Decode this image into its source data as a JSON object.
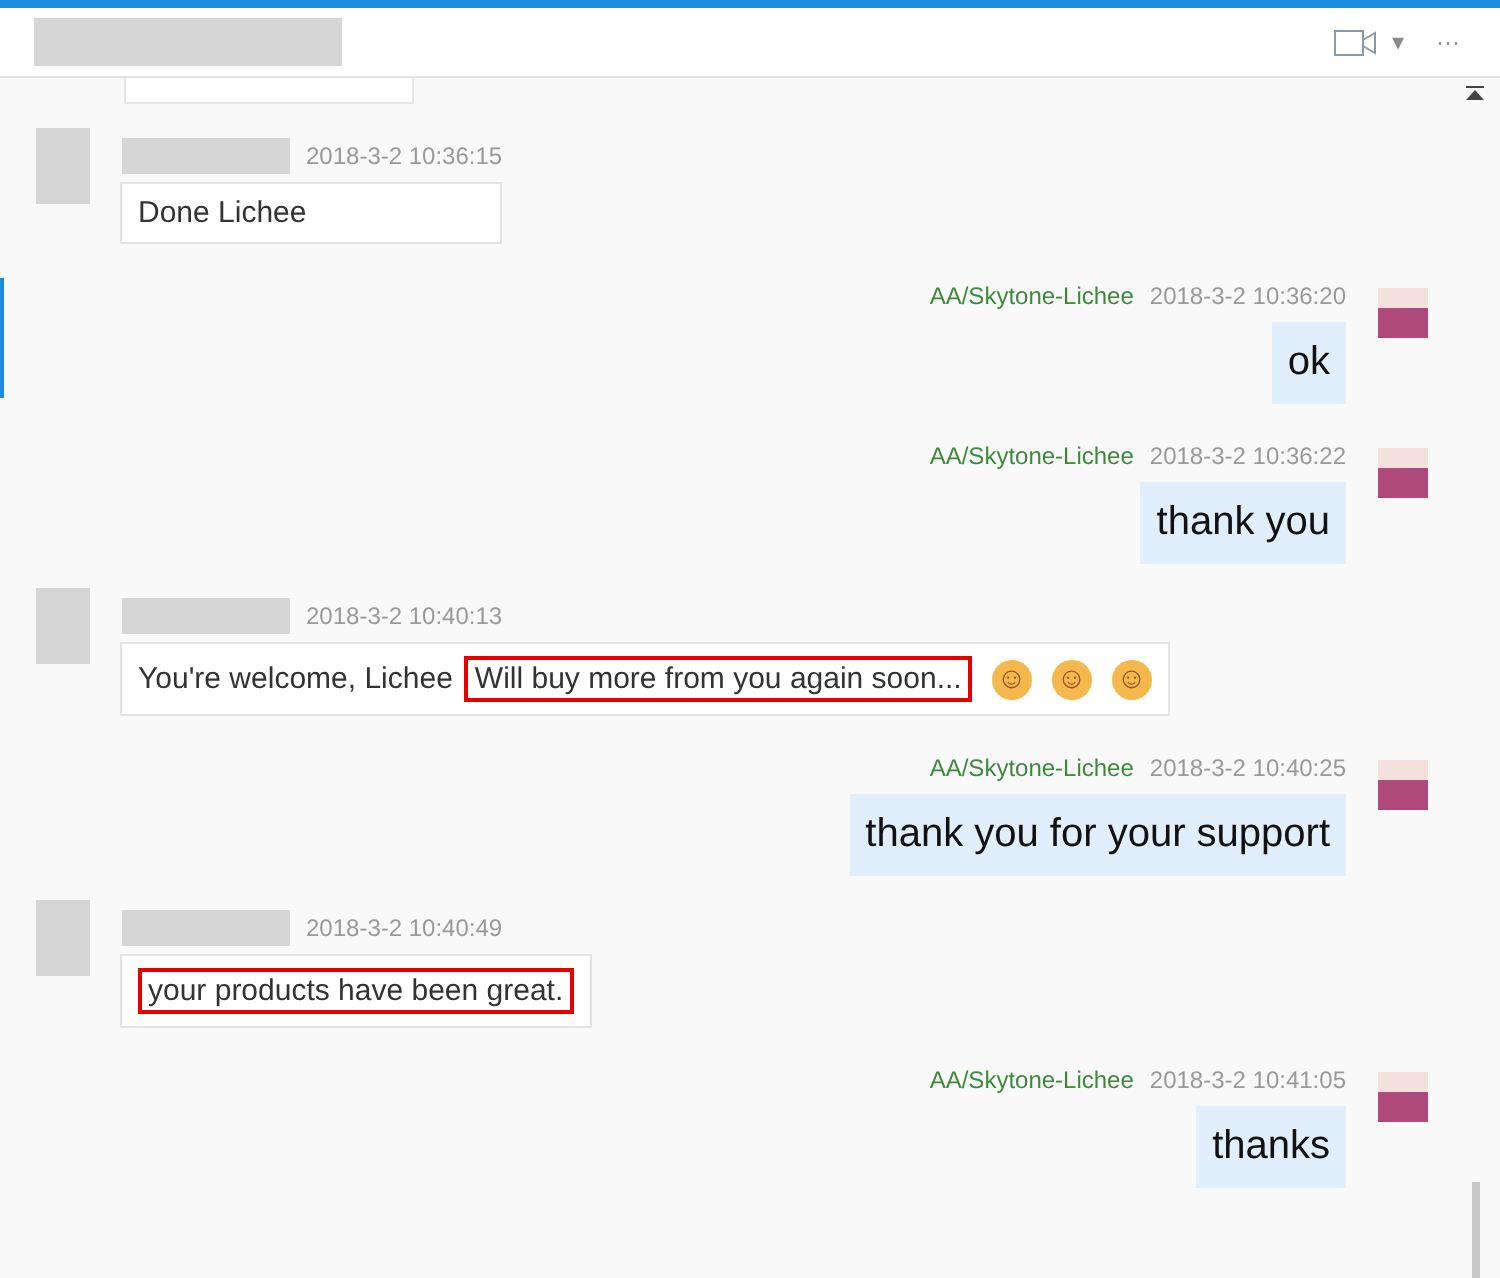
{
  "header": {
    "actions": [
      "▾",
      "···"
    ]
  },
  "messages": [
    {
      "kind": "incoming",
      "time": "2018-3-2 10:36:15",
      "parts": [
        {
          "text": "Done Lichee",
          "highlighted": false
        }
      ]
    },
    {
      "kind": "outgoing",
      "sender": "AA/Skytone-Lichee",
      "time": "2018-3-2 10:36:20",
      "parts": [
        {
          "text": "ok",
          "highlighted": false
        }
      ]
    },
    {
      "kind": "outgoing",
      "sender": "AA/Skytone-Lichee",
      "time": "2018-3-2 10:36:22",
      "parts": [
        {
          "text": "thank you",
          "highlighted": false
        }
      ]
    },
    {
      "kind": "incoming",
      "time": "2018-3-2 10:40:13",
      "parts": [
        {
          "text": "You're welcome, Lichee",
          "highlighted": false
        },
        {
          "text": "Will buy more from you again soon...",
          "highlighted": true
        }
      ],
      "emojis": [
        "☺",
        "☺",
        "☺"
      ]
    },
    {
      "kind": "outgoing",
      "sender": "AA/Skytone-Lichee",
      "time": "2018-3-2 10:40:25",
      "parts": [
        {
          "text": "thank you for your support",
          "highlighted": false
        }
      ]
    },
    {
      "kind": "incoming",
      "time": "2018-3-2 10:40:49",
      "parts": [
        {
          "text": "your products have been great.",
          "highlighted": true
        }
      ]
    },
    {
      "kind": "outgoing",
      "sender": "AA/Skytone-Lichee",
      "time": "2018-3-2 10:41:05",
      "parts": [
        {
          "text": "thanks",
          "highlighted": false
        }
      ]
    }
  ]
}
